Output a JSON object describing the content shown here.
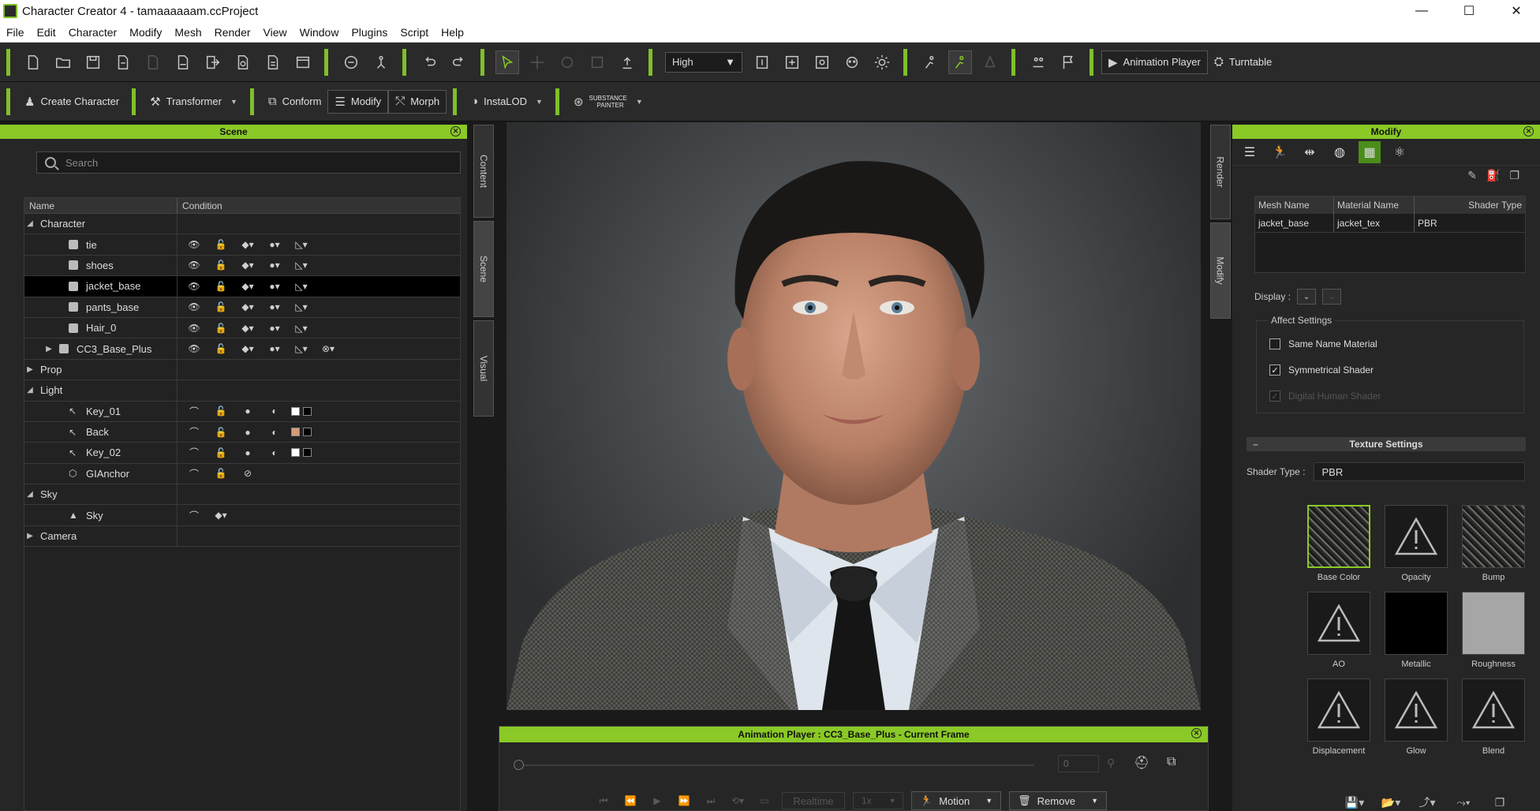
{
  "window": {
    "title": "Character Creator 4 - tamaaaaaam.ccProject",
    "minimize": "—",
    "maximize": "☐",
    "close": "✕"
  },
  "menu": [
    "File",
    "Edit",
    "Character",
    "Modify",
    "Mesh",
    "Render",
    "View",
    "Window",
    "Plugins",
    "Script",
    "Help"
  ],
  "toolbar": {
    "quality": "High",
    "animation_player": "Animation Player",
    "turntable": "Turntable"
  },
  "toolbar2": {
    "create_character": "Create Character",
    "transformer": "Transformer",
    "conform": "Conform",
    "modify": "Modify",
    "morph": "Morph",
    "instalod": "InstaLOD",
    "substance_top": "SUBSTANCE",
    "substance_bottom": "PAINTER"
  },
  "scene": {
    "header": "Scene",
    "search_placeholder": "Search",
    "col_name": "Name",
    "col_condition": "Condition",
    "rows": [
      {
        "label": "Character",
        "level": 0,
        "expander": "◢"
      },
      {
        "label": "tie",
        "level": 2
      },
      {
        "label": "shoes",
        "level": 2
      },
      {
        "label": "jacket_base",
        "level": 2
      },
      {
        "label": "pants_base",
        "level": 2
      },
      {
        "label": "Hair_0",
        "level": 2
      },
      {
        "label": "CC3_Base_Plus",
        "level": 1,
        "expander": "▶"
      },
      {
        "label": "Prop",
        "level": 0,
        "expander": "▶"
      },
      {
        "label": "Light",
        "level": 0,
        "expander": "◢"
      },
      {
        "label": "Key_01",
        "level": 2
      },
      {
        "label": "Back",
        "level": 2
      },
      {
        "label": "Key_02",
        "level": 2
      },
      {
        "label": "GIAnchor",
        "level": 2
      },
      {
        "label": "Sky",
        "level": 0,
        "expander": "◢"
      },
      {
        "label": "Sky",
        "level": 2
      },
      {
        "label": "Camera",
        "level": 0,
        "expander": "▶"
      }
    ]
  },
  "side_tabs": {
    "content": "Content",
    "scene": "Scene",
    "visual": "Visual",
    "render": "Render",
    "modify": "Modify"
  },
  "animation_player": {
    "header": "Animation Player : CC3_Base_Plus - Current Frame",
    "frame": "0",
    "realtime": "Realtime",
    "speed": "1x",
    "motion": "Motion",
    "remove": "Remove"
  },
  "modify": {
    "header": "Modify",
    "table": {
      "headers": [
        "Mesh Name",
        "Material Name",
        "Shader Type"
      ],
      "row": [
        "jacket_base",
        "jacket_tex",
        "PBR"
      ]
    },
    "display_label": "Display :",
    "affect_settings": "Affect Settings",
    "same_name_material": "Same Name Material",
    "symmetrical_shader": "Symmetrical Shader",
    "digital_human_shader": "Digital Human Shader",
    "texture_settings": "Texture Settings",
    "shader_type_label": "Shader Type :",
    "shader_type_value": "PBR",
    "textures": [
      {
        "label": "Base Color",
        "kind": "pattern",
        "selected": true
      },
      {
        "label": "Opacity",
        "kind": "warning"
      },
      {
        "label": "Bump",
        "kind": "pattern"
      },
      {
        "label": "AO",
        "kind": "warning"
      },
      {
        "label": "Metallic",
        "kind": "black"
      },
      {
        "label": "Roughness",
        "kind": "gray"
      },
      {
        "label": "Displacement",
        "kind": "warning"
      },
      {
        "label": "Glow",
        "kind": "warning"
      },
      {
        "label": "Blend",
        "kind": "warning"
      }
    ]
  }
}
